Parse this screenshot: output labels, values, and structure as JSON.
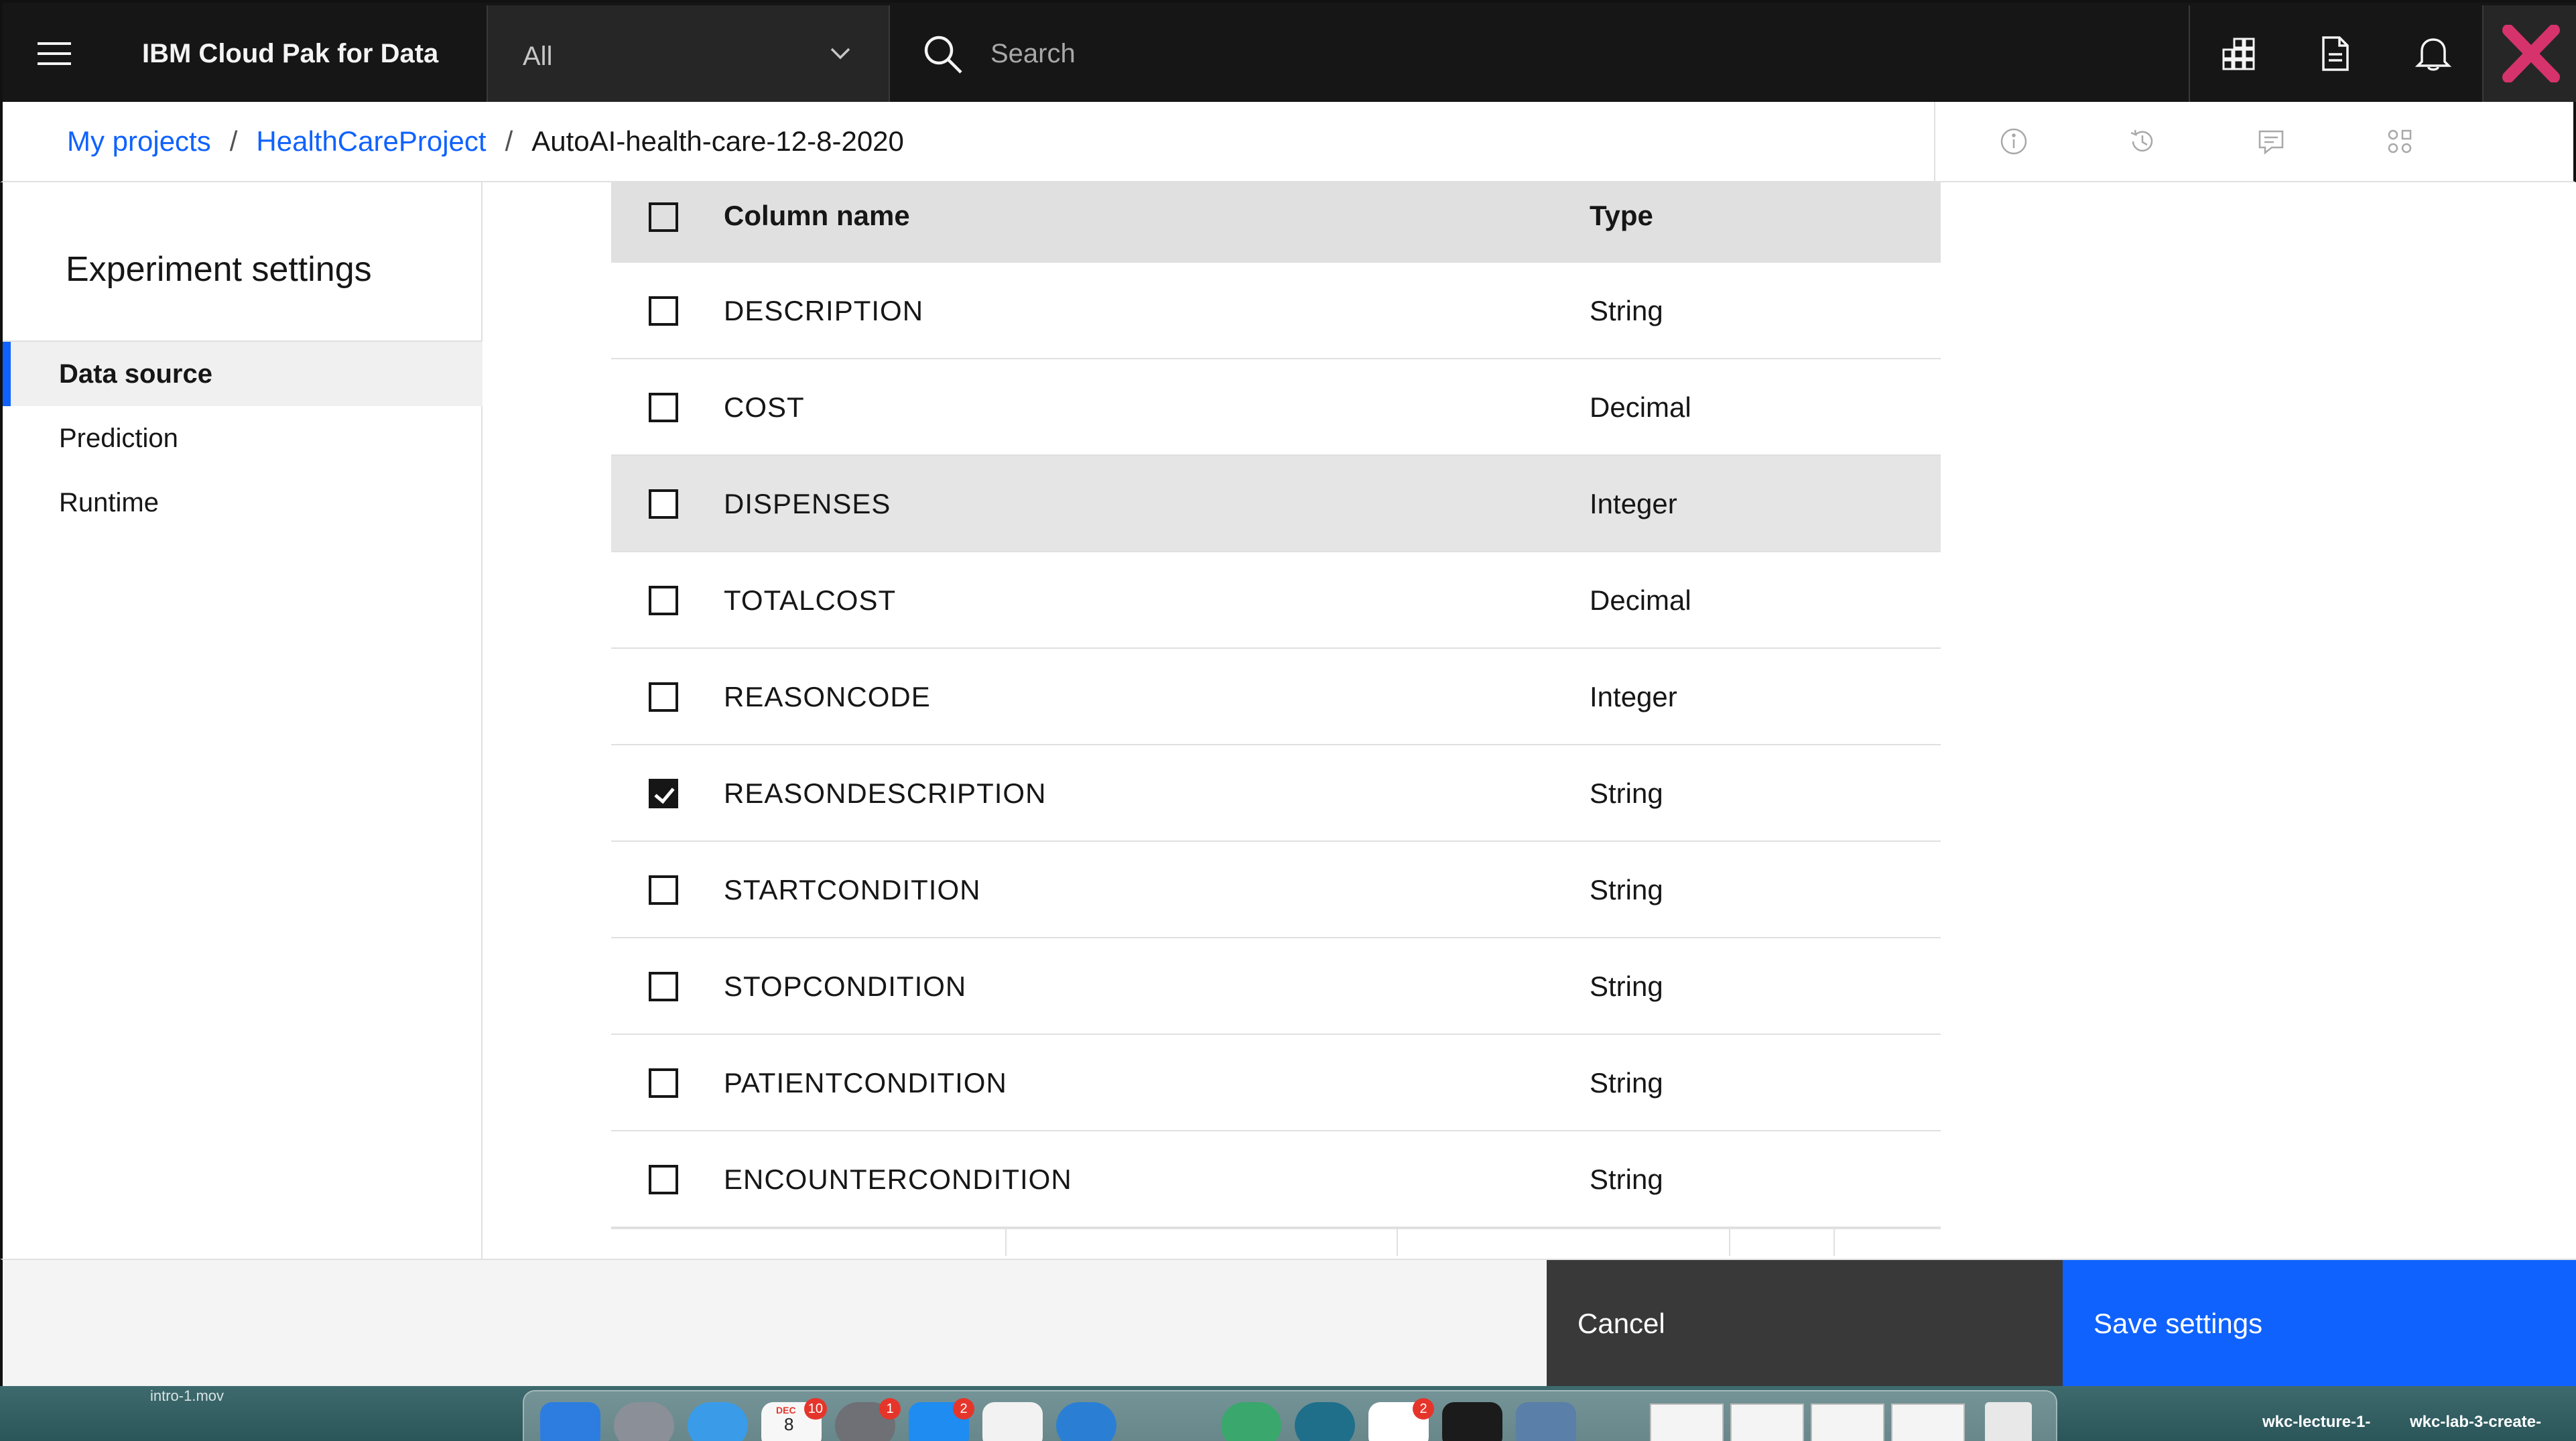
{
  "header": {
    "brand": "IBM Cloud Pak for Data",
    "scope_selector": "All",
    "search_placeholder": "Search"
  },
  "breadcrumb": {
    "items": [
      "My projects",
      "HealthCareProject"
    ],
    "separator": "/",
    "current": "AutoAI-health-care-12-8-2020"
  },
  "sidebar": {
    "title": "Experiment settings",
    "items": [
      {
        "label": "Data source",
        "active": true
      },
      {
        "label": "Prediction",
        "active": false
      },
      {
        "label": "Runtime",
        "active": false
      }
    ]
  },
  "table": {
    "columns": [
      "Column name",
      "Type"
    ],
    "rows": [
      {
        "name": "DESCRIPTION",
        "type": "String",
        "checked": false
      },
      {
        "name": "COST",
        "type": "Decimal",
        "checked": false
      },
      {
        "name": "DISPENSES",
        "type": "Integer",
        "checked": false
      },
      {
        "name": "TOTALCOST",
        "type": "Decimal",
        "checked": false
      },
      {
        "name": "REASONCODE",
        "type": "Integer",
        "checked": false
      },
      {
        "name": "REASONDESCRIPTION",
        "type": "String",
        "checked": true
      },
      {
        "name": "STARTCONDITION",
        "type": "String",
        "checked": false
      },
      {
        "name": "STOPCONDITION",
        "type": "String",
        "checked": false
      },
      {
        "name": "PATIENTCONDITION",
        "type": "String",
        "checked": false
      },
      {
        "name": "ENCOUNTERCONDITION",
        "type": "String",
        "checked": false
      }
    ]
  },
  "footer": {
    "cancel_label": "Cancel",
    "save_label": "Save settings"
  },
  "desktop": {
    "file_label": "intro-1.mov",
    "dock_badges": [
      "10",
      "1",
      "2",
      "2"
    ],
    "calendar_month": "DEC",
    "calendar_day": "8",
    "window_labels": [
      "wkc-lecture-1-",
      "wkc-lab-3-create-"
    ]
  },
  "colors": {
    "header_bg": "#161616",
    "accent": "#0f62fe",
    "cancel_bg": "#393939",
    "hover_row": "#e5e5e5"
  },
  "icons": {
    "menu": "hamburger-icon",
    "search": "search-icon",
    "apps": "apps-icon",
    "doc": "document-icon",
    "notification": "bell-icon",
    "avatar": "close-x-icon"
  }
}
